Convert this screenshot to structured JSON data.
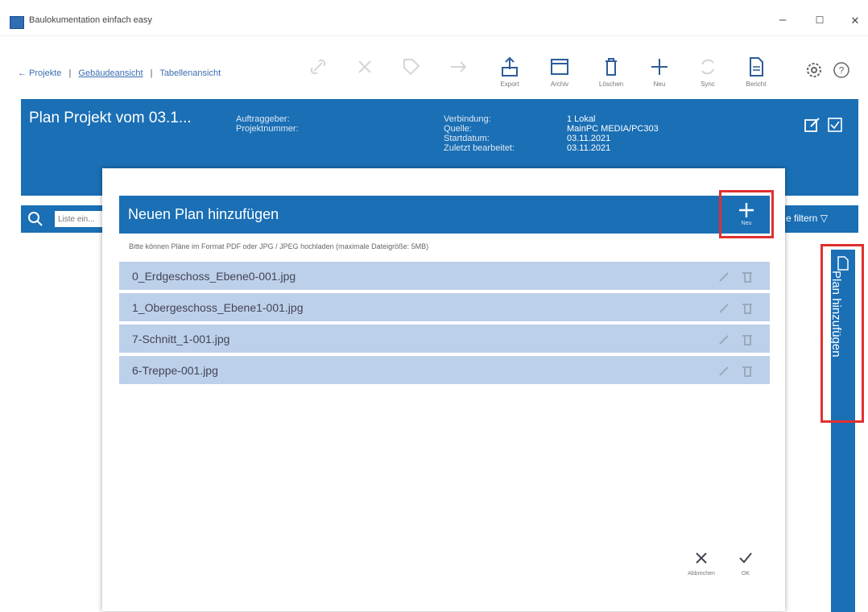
{
  "window": {
    "title": "Baulokumentation einfach easy",
    "minimize": "–",
    "maximize": "☐",
    "close": "✕"
  },
  "nav": {
    "back": "← Projekte",
    "sep1": "|",
    "mid": "Gebäudeansicht",
    "sep2": "|",
    "last": "Tabellenansicht"
  },
  "toolbar": {
    "labels": [
      "",
      "",
      "",
      "",
      "Export",
      "Archiv",
      "Löschen",
      "Neu",
      "Sync",
      "Bericht"
    ]
  },
  "project": {
    "title": "Plan Projekt vom 03.1...",
    "left_labels": [
      "Auftraggeber:",
      "Projektnummer:"
    ],
    "info_labels": [
      "Verbindung:",
      "Quelle:",
      "Startdatum:",
      "Zuletzt bearbeitet:"
    ],
    "info_values": [
      "1 Lokal",
      "MainPC MEDIA/PC303",
      "03.11.2021",
      "03.11.2021"
    ]
  },
  "search": {
    "placeholder": "Liste ein...",
    "filter": "e filtern"
  },
  "side_tab": {
    "label": "Plan hinzufügen"
  },
  "dialog": {
    "title": "Neuen Plan hinzufügen",
    "add_label": "Neu",
    "hint": "Bitte können Pläne im Format PDF oder JPG / JPEG hochladen (maximale Dateigröße: 5MB)",
    "files": [
      "0_Erdgeschoss_Ebene0-001.jpg",
      "1_Obergeschoss_Ebene1-001.jpg",
      "7-Schnitt_1-001.jpg",
      "6-Treppe-001.jpg"
    ],
    "cancel_label": "Abbrechen",
    "ok_label": "OK"
  }
}
